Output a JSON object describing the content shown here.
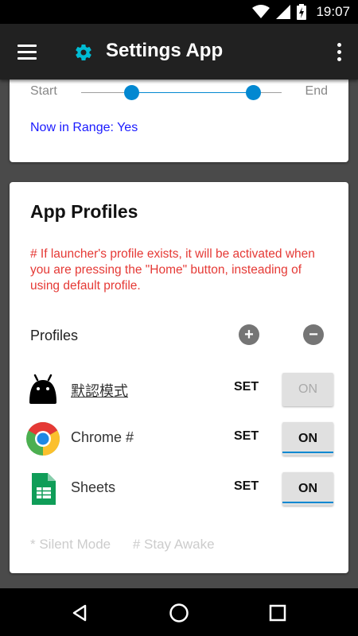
{
  "status_bar": {
    "time": "19:07",
    "icons": [
      "wifi-icon",
      "signal-icon",
      "battery-charging-icon"
    ]
  },
  "app_bar": {
    "title": "Settings App",
    "icons": [
      "menu-icon",
      "gear-icon",
      "overflow-menu-icon"
    ]
  },
  "range_card": {
    "start_label": "Start",
    "end_label": "End",
    "range_low": 0.25,
    "range_high": 0.86,
    "status_text": "Now in Range: Yes"
  },
  "profiles_card": {
    "title": "App Profiles",
    "note": "# If launcher's profile exists, it will be activated when you are pressing the \"Home\" button, insteading of using default profile.",
    "profiles_label": "Profiles",
    "add_symbol": "+",
    "remove_symbol": "−",
    "profiles": [
      {
        "name": "默認模式",
        "icon": "android-icon",
        "set_label": "SET",
        "toggle_label": "ON",
        "toggle_state": "disabled"
      },
      {
        "name": "Chrome #",
        "icon": "chrome-icon",
        "set_label": "SET",
        "toggle_label": "ON",
        "toggle_state": "on"
      },
      {
        "name": "Sheets",
        "icon": "sheets-icon",
        "set_label": "SET",
        "toggle_label": "ON",
        "toggle_state": "on"
      }
    ],
    "footer_tags": [
      "* Silent Mode",
      "# Stay Awake"
    ]
  },
  "colors": {
    "accent": "#0288d1",
    "app_bar": "#212121",
    "note_red": "#e53935",
    "link_blue": "#1a1aff",
    "gear_cyan": "#00bcd4"
  }
}
